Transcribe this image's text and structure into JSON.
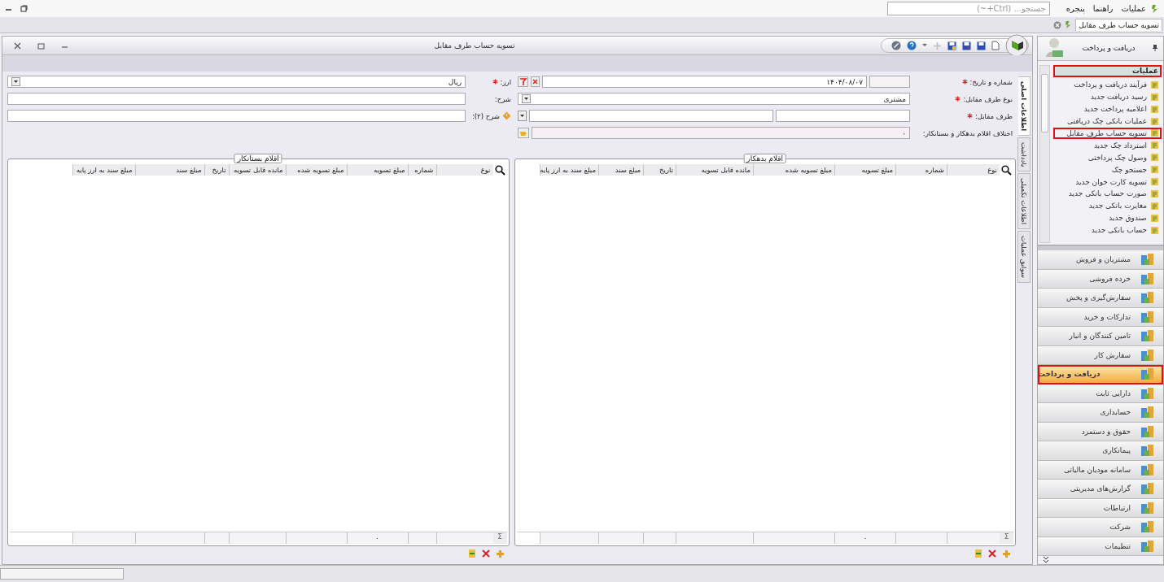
{
  "menu_bar": {
    "items": [
      {
        "label": "عملیات"
      },
      {
        "label": "راهنما"
      },
      {
        "label": "پنجره"
      }
    ],
    "search": {
      "placeholder": "جستجو... (Ctrl+~)"
    }
  },
  "document_tabs": [
    {
      "label": "تسویه حساب طرف مقابل",
      "selected": true
    }
  ],
  "window": {
    "title": "تسویه حساب طرف مقابل"
  },
  "form": {
    "right_fields": [
      {
        "kind": "number_date",
        "label": "شماره و تاریخ:",
        "required": true,
        "date": "۱۴۰۴/۰۸/۰۷"
      },
      {
        "kind": "select",
        "label": "نوع طرف مقابل:",
        "required": true,
        "value": "مشتری"
      },
      {
        "kind": "lookup",
        "label": "طرف مقابل:",
        "required": true
      },
      {
        "kind": "readonly",
        "label": "اختلاف اقلام بدهکار و بستانکار:",
        "required": false,
        "value": "۰"
      }
    ],
    "left_fields": [
      {
        "kind": "select",
        "label": "ارز:",
        "required": true,
        "value": "ریال"
      },
      {
        "kind": "text",
        "label": "شرح:",
        "required": false
      },
      {
        "kind": "text_flagged",
        "label": "شرح (۲):",
        "required": false
      }
    ]
  },
  "side_tabs": [
    {
      "label": "اطلاعات اصلی",
      "selected": true
    },
    {
      "label": "یادداشت",
      "selected": false
    },
    {
      "label": "اطلاعات تکمیلی",
      "selected": false
    },
    {
      "label": "سوابق عملیات",
      "selected": false
    }
  ],
  "grids": [
    {
      "title": "اقلام بدهکار",
      "sum_label": "Σ",
      "columns": [
        {
          "label": "نوع"
        },
        {
          "label": "شماره"
        },
        {
          "label": "مبلغ تسویه",
          "total": "۰"
        },
        {
          "label": "مبلغ تسویه شده"
        },
        {
          "label": "مانده قابل تسویه"
        },
        {
          "label": "تاریخ"
        },
        {
          "label": "مبلغ سند"
        },
        {
          "label": "مبلغ سند به ارز پایه"
        }
      ]
    },
    {
      "title": "اقلام بستانکار",
      "sum_label": "Σ",
      "columns": [
        {
          "label": "نوع"
        },
        {
          "label": "شماره"
        },
        {
          "label": "مبلغ تسویه",
          "total": "۰"
        },
        {
          "label": "مبلغ تسویه شده"
        },
        {
          "label": "مانده قابل تسویه"
        },
        {
          "label": "تاریخ"
        },
        {
          "label": "مبلغ سند"
        },
        {
          "label": "مبلغ سند به ارز پایه"
        }
      ]
    }
  ],
  "sidebar": {
    "title": "دریافت و پرداخت",
    "group": {
      "label": "عملیات",
      "annotated": true
    },
    "items": [
      {
        "label": "فرآیند دریافت و پرداخت",
        "annotated": false
      },
      {
        "label": "رسید دریافت جدید",
        "annotated": false
      },
      {
        "label": "اعلامیه پرداخت جدید",
        "annotated": false
      },
      {
        "label": "عملیات بانکی چک دریافتی",
        "annotated": false
      },
      {
        "label": "تسویه حساب طرف مقابل",
        "annotated": true
      },
      {
        "label": "استرداد چک جدید",
        "annotated": false
      },
      {
        "label": "وصول چک پرداختی",
        "annotated": false
      },
      {
        "label": "جستجو چک",
        "annotated": false
      },
      {
        "label": "تسویه کارت خوان جدید",
        "annotated": false
      },
      {
        "label": "صورت حساب بانکی جدید",
        "annotated": false
      },
      {
        "label": "مغایرت بانکی جدید",
        "annotated": false
      },
      {
        "label": "صندوق جدید",
        "annotated": false
      },
      {
        "label": "حساب بانکی جدید",
        "annotated": false
      }
    ],
    "modules": [
      {
        "label": "مشتریان و فروش",
        "selected": false
      },
      {
        "label": "خرده فروشی",
        "selected": false
      },
      {
        "label": "سفارش‌گیری و پخش",
        "selected": false
      },
      {
        "label": "تدارکات و خرید",
        "selected": false
      },
      {
        "label": "تامین کنندگان و انبار",
        "selected": false
      },
      {
        "label": "سفارش کار",
        "selected": false
      },
      {
        "label": "دریافت و پرداخت",
        "selected": true
      },
      {
        "label": "دارایی ثابت",
        "selected": false
      },
      {
        "label": "حسابداری",
        "selected": false
      },
      {
        "label": "حقوق و دستمزد",
        "selected": false
      },
      {
        "label": "پیمانکاری",
        "selected": false
      },
      {
        "label": "سامانه مودیان مالیاتی",
        "selected": false
      },
      {
        "label": "گزارش‌های مدیریتی",
        "selected": false
      },
      {
        "label": "ارتباطات",
        "selected": false
      },
      {
        "label": "شرکت",
        "selected": false
      },
      {
        "label": "تنظیمات",
        "selected": false
      }
    ]
  }
}
